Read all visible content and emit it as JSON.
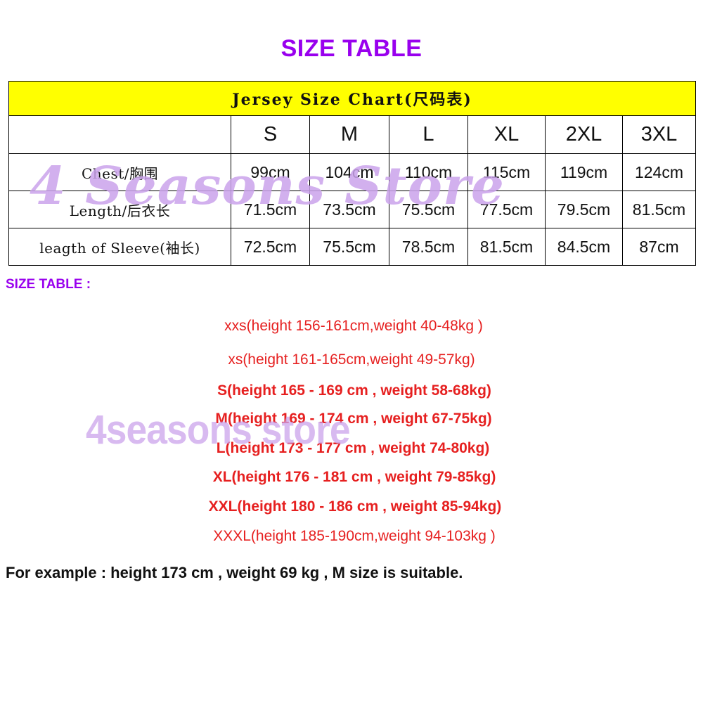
{
  "title": "SIZE TABLE",
  "colors": {
    "title_purple": "#9900EE",
    "banner_yellow": "#FFFF00",
    "list_red": "#E62020",
    "watermark_purple": "#CBA3EC",
    "text_black": "#111111"
  },
  "chart": {
    "banner": "Jersey Size Chart(尺码表)",
    "columns": [
      "",
      "S",
      "M",
      "L",
      "XL",
      "2XL",
      "3XL"
    ],
    "rows": [
      {
        "label": "Chest/胸围",
        "values": [
          "99cm",
          "104cm",
          "110cm",
          "115cm",
          "119cm",
          "124cm"
        ]
      },
      {
        "label": "Length/后衣长",
        "values": [
          "71.5cm",
          "73.5cm",
          "75.5cm",
          "77.5cm",
          "79.5cm",
          "81.5cm"
        ]
      },
      {
        "label": "leagth of Sleeve(袖长)",
        "values": [
          "72.5cm",
          "75.5cm",
          "78.5cm",
          "81.5cm",
          "84.5cm",
          "87cm"
        ]
      }
    ]
  },
  "size_table_label": "SIZE TABLE :",
  "size_list": [
    "xxs(height 156-161cm,weight 40-48kg )",
    "xs(height 161-165cm,weight 49-57kg)",
    "S(height 165 - 169 cm , weight 58-68kg)",
    "M(height 169 - 174 cm , weight 67-75kg)",
    "L(height 173 - 177 cm , weight 74-80kg)",
    "XL(height 176 - 181 cm , weight 79-85kg)",
    "XXL(height 180 - 186 cm , weight 85-94kg)",
    "XXXL(height 185-190cm,weight 94-103kg )"
  ],
  "example": "For example : height 173 cm , weight 69 kg , M size is suitable.",
  "watermarks": {
    "top": "4 Seasons Store",
    "middle": "4seasons store"
  }
}
